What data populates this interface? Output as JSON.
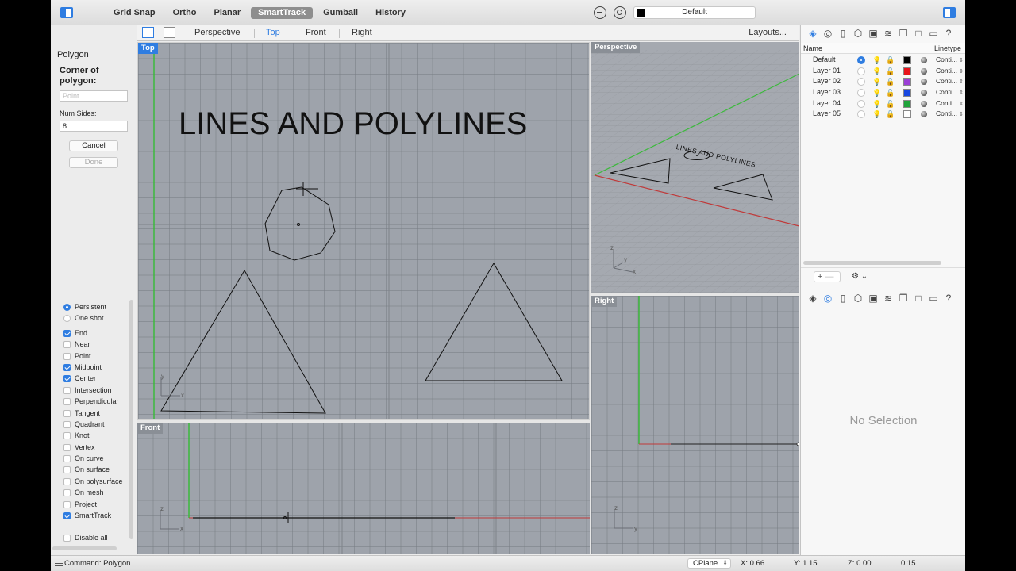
{
  "toolbar": {
    "toggles": [
      {
        "label": "Grid Snap",
        "active": false
      },
      {
        "label": "Ortho",
        "active": false
      },
      {
        "label": "Planar",
        "active": false
      },
      {
        "label": "SmartTrack",
        "active": true
      },
      {
        "label": "Gumball",
        "active": false
      },
      {
        "label": "History",
        "active": false
      }
    ],
    "current_layer": "Default"
  },
  "viewport_tabs": {
    "tabs": [
      "Perspective",
      "Top",
      "Front",
      "Right"
    ],
    "active": "Top",
    "layouts_label": "Layouts..."
  },
  "command_panel": {
    "title": "Polygon",
    "prompt": "Corner of polygon:",
    "point_placeholder": "Point",
    "num_sides_label": "Num Sides:",
    "num_sides_value": "8",
    "cancel_label": "Cancel",
    "done_label": "Done"
  },
  "osnap": {
    "modes": [
      {
        "label": "Persistent",
        "type": "radio",
        "checked": true
      },
      {
        "label": "One shot",
        "type": "radio",
        "checked": false
      }
    ],
    "snaps": [
      {
        "label": "End",
        "checked": true
      },
      {
        "label": "Near",
        "checked": false
      },
      {
        "label": "Point",
        "checked": false
      },
      {
        "label": "Midpoint",
        "checked": true
      },
      {
        "label": "Center",
        "checked": true
      },
      {
        "label": "Intersection",
        "checked": false
      },
      {
        "label": "Perpendicular",
        "checked": false
      },
      {
        "label": "Tangent",
        "checked": false
      },
      {
        "label": "Quadrant",
        "checked": false
      },
      {
        "label": "Knot",
        "checked": false
      },
      {
        "label": "Vertex",
        "checked": false
      },
      {
        "label": "On curve",
        "checked": false
      },
      {
        "label": "On surface",
        "checked": false
      },
      {
        "label": "On polysurface",
        "checked": false
      },
      {
        "label": "On mesh",
        "checked": false
      },
      {
        "label": "Project",
        "checked": false
      },
      {
        "label": "SmartTrack",
        "checked": true
      }
    ],
    "disable_all_label": "Disable all"
  },
  "viewports": {
    "top": {
      "label": "Top",
      "text": "LINES AND POLYLINES",
      "axis_x": "x",
      "axis_y": "y"
    },
    "front": {
      "label": "Front",
      "axis_x": "x",
      "axis_z": "z"
    },
    "perspective": {
      "label": "Perspective",
      "text": "LINES AND POLYLINES",
      "axis_x": "x",
      "axis_y": "y",
      "axis_z": "z"
    },
    "right": {
      "label": "Right",
      "axis_y": "y",
      "axis_z": "z"
    }
  },
  "layers": {
    "headers": {
      "name": "Name",
      "linetype": "Linetype"
    },
    "rows": [
      {
        "name": "Default",
        "current": true,
        "color": "#000000",
        "linetype": "Conti..."
      },
      {
        "name": "Layer 01",
        "current": false,
        "color": "#e8141c",
        "linetype": "Conti..."
      },
      {
        "name": "Layer 02",
        "current": false,
        "color": "#9b3fd6",
        "linetype": "Conti..."
      },
      {
        "name": "Layer 03",
        "current": false,
        "color": "#1747e0",
        "linetype": "Conti..."
      },
      {
        "name": "Layer 04",
        "current": false,
        "color": "#1fa33a",
        "linetype": "Conti..."
      },
      {
        "name": "Layer 05",
        "current": false,
        "color": "#ffffff",
        "linetype": "Conti..."
      }
    ]
  },
  "properties": {
    "no_selection": "No Selection"
  },
  "status": {
    "command": "Command: Polygon",
    "cplane": "CPlane",
    "x": "X: 0.66",
    "y": "Y: 1.15",
    "z": "Z: 0.00",
    "extra": "0.15"
  }
}
